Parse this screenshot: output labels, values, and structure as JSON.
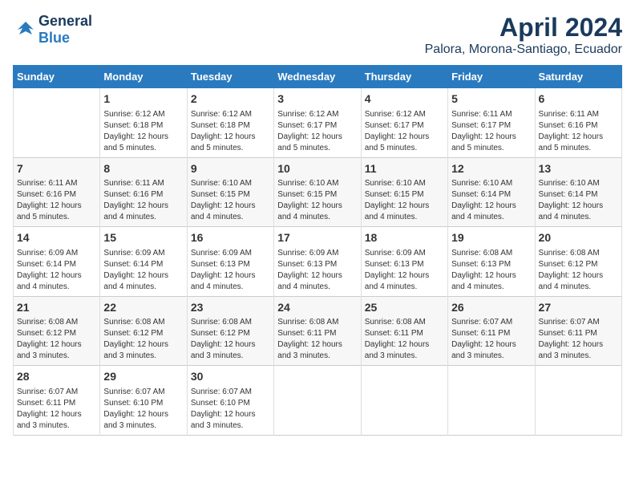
{
  "logo": {
    "general": "General",
    "blue": "Blue"
  },
  "title": "April 2024",
  "subtitle": "Palora, Morona-Santiago, Ecuador",
  "weekdays": [
    "Sunday",
    "Monday",
    "Tuesday",
    "Wednesday",
    "Thursday",
    "Friday",
    "Saturday"
  ],
  "weeks": [
    [
      {
        "day": "",
        "info": ""
      },
      {
        "day": "1",
        "info": "Sunrise: 6:12 AM\nSunset: 6:18 PM\nDaylight: 12 hours\nand 5 minutes."
      },
      {
        "day": "2",
        "info": "Sunrise: 6:12 AM\nSunset: 6:18 PM\nDaylight: 12 hours\nand 5 minutes."
      },
      {
        "day": "3",
        "info": "Sunrise: 6:12 AM\nSunset: 6:17 PM\nDaylight: 12 hours\nand 5 minutes."
      },
      {
        "day": "4",
        "info": "Sunrise: 6:12 AM\nSunset: 6:17 PM\nDaylight: 12 hours\nand 5 minutes."
      },
      {
        "day": "5",
        "info": "Sunrise: 6:11 AM\nSunset: 6:17 PM\nDaylight: 12 hours\nand 5 minutes."
      },
      {
        "day": "6",
        "info": "Sunrise: 6:11 AM\nSunset: 6:16 PM\nDaylight: 12 hours\nand 5 minutes."
      }
    ],
    [
      {
        "day": "7",
        "info": "Sunrise: 6:11 AM\nSunset: 6:16 PM\nDaylight: 12 hours\nand 5 minutes."
      },
      {
        "day": "8",
        "info": "Sunrise: 6:11 AM\nSunset: 6:16 PM\nDaylight: 12 hours\nand 4 minutes."
      },
      {
        "day": "9",
        "info": "Sunrise: 6:10 AM\nSunset: 6:15 PM\nDaylight: 12 hours\nand 4 minutes."
      },
      {
        "day": "10",
        "info": "Sunrise: 6:10 AM\nSunset: 6:15 PM\nDaylight: 12 hours\nand 4 minutes."
      },
      {
        "day": "11",
        "info": "Sunrise: 6:10 AM\nSunset: 6:15 PM\nDaylight: 12 hours\nand 4 minutes."
      },
      {
        "day": "12",
        "info": "Sunrise: 6:10 AM\nSunset: 6:14 PM\nDaylight: 12 hours\nand 4 minutes."
      },
      {
        "day": "13",
        "info": "Sunrise: 6:10 AM\nSunset: 6:14 PM\nDaylight: 12 hours\nand 4 minutes."
      }
    ],
    [
      {
        "day": "14",
        "info": "Sunrise: 6:09 AM\nSunset: 6:14 PM\nDaylight: 12 hours\nand 4 minutes."
      },
      {
        "day": "15",
        "info": "Sunrise: 6:09 AM\nSunset: 6:14 PM\nDaylight: 12 hours\nand 4 minutes."
      },
      {
        "day": "16",
        "info": "Sunrise: 6:09 AM\nSunset: 6:13 PM\nDaylight: 12 hours\nand 4 minutes."
      },
      {
        "day": "17",
        "info": "Sunrise: 6:09 AM\nSunset: 6:13 PM\nDaylight: 12 hours\nand 4 minutes."
      },
      {
        "day": "18",
        "info": "Sunrise: 6:09 AM\nSunset: 6:13 PM\nDaylight: 12 hours\nand 4 minutes."
      },
      {
        "day": "19",
        "info": "Sunrise: 6:08 AM\nSunset: 6:13 PM\nDaylight: 12 hours\nand 4 minutes."
      },
      {
        "day": "20",
        "info": "Sunrise: 6:08 AM\nSunset: 6:12 PM\nDaylight: 12 hours\nand 4 minutes."
      }
    ],
    [
      {
        "day": "21",
        "info": "Sunrise: 6:08 AM\nSunset: 6:12 PM\nDaylight: 12 hours\nand 3 minutes."
      },
      {
        "day": "22",
        "info": "Sunrise: 6:08 AM\nSunset: 6:12 PM\nDaylight: 12 hours\nand 3 minutes."
      },
      {
        "day": "23",
        "info": "Sunrise: 6:08 AM\nSunset: 6:12 PM\nDaylight: 12 hours\nand 3 minutes."
      },
      {
        "day": "24",
        "info": "Sunrise: 6:08 AM\nSunset: 6:11 PM\nDaylight: 12 hours\nand 3 minutes."
      },
      {
        "day": "25",
        "info": "Sunrise: 6:08 AM\nSunset: 6:11 PM\nDaylight: 12 hours\nand 3 minutes."
      },
      {
        "day": "26",
        "info": "Sunrise: 6:07 AM\nSunset: 6:11 PM\nDaylight: 12 hours\nand 3 minutes."
      },
      {
        "day": "27",
        "info": "Sunrise: 6:07 AM\nSunset: 6:11 PM\nDaylight: 12 hours\nand 3 minutes."
      }
    ],
    [
      {
        "day": "28",
        "info": "Sunrise: 6:07 AM\nSunset: 6:11 PM\nDaylight: 12 hours\nand 3 minutes."
      },
      {
        "day": "29",
        "info": "Sunrise: 6:07 AM\nSunset: 6:10 PM\nDaylight: 12 hours\nand 3 minutes."
      },
      {
        "day": "30",
        "info": "Sunrise: 6:07 AM\nSunset: 6:10 PM\nDaylight: 12 hours\nand 3 minutes."
      },
      {
        "day": "",
        "info": ""
      },
      {
        "day": "",
        "info": ""
      },
      {
        "day": "",
        "info": ""
      },
      {
        "day": "",
        "info": ""
      }
    ]
  ]
}
